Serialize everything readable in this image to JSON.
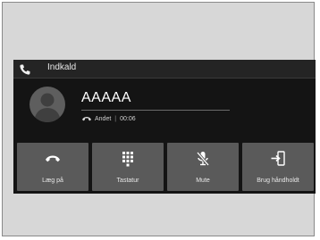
{
  "header": {
    "title": "Indkald"
  },
  "caller": {
    "name": "AAAAA",
    "type": "Andet",
    "duration": "00:06"
  },
  "buttons": [
    {
      "label": "Læg på",
      "icon": "hang-up-icon"
    },
    {
      "label": "Tastatur",
      "icon": "keypad-icon"
    },
    {
      "label": "Mute",
      "icon": "mute-mic-icon"
    },
    {
      "label": "Brug håndholdt",
      "icon": "handset-transfer-icon"
    }
  ],
  "colors": {
    "screen": "#141414",
    "button": "#5a5a5a",
    "frame": "#d7d7d7"
  }
}
